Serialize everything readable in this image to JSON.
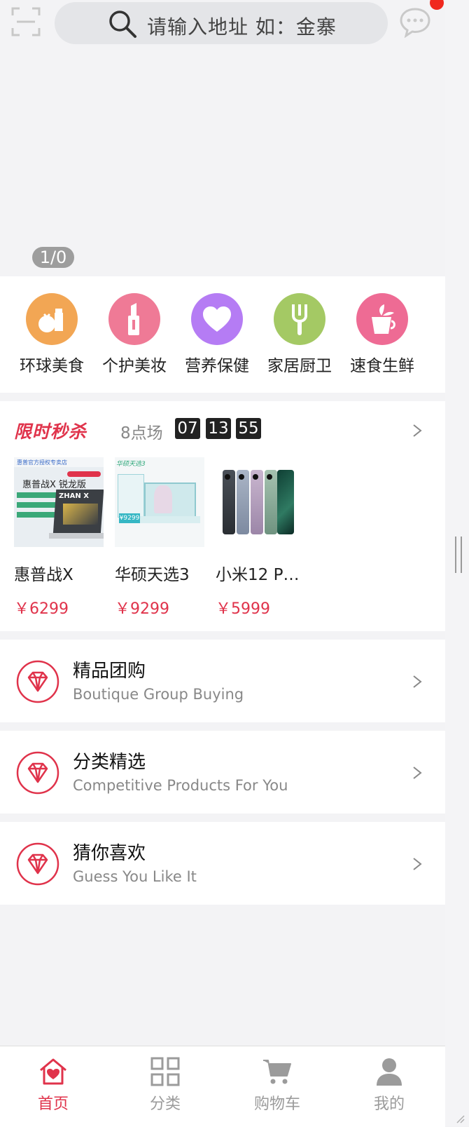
{
  "header": {
    "search_placeholder": "请输入地址 如：金寨"
  },
  "banner": {
    "indicator": "1/0"
  },
  "categories": [
    {
      "label": "环球美食",
      "color": "#f2a654",
      "icon": "fruit-bottle-icon"
    },
    {
      "label": "个护美妆",
      "color": "#ef7a96",
      "icon": "lipstick-icon"
    },
    {
      "label": "营养保健",
      "color": "#b57cf4",
      "icon": "heart-icon"
    },
    {
      "label": "家居厨卫",
      "color": "#a4c964",
      "icon": "fork-icon"
    },
    {
      "label": "速食生鲜",
      "color": "#ee6b94",
      "icon": "cup-icon"
    }
  ],
  "flash_sale": {
    "title": "限时秒杀",
    "session": "8点场",
    "countdown": {
      "hours": "07",
      "minutes": "13",
      "seconds": "55"
    },
    "products": [
      {
        "name": "惠普战X",
        "price": "￥6299",
        "img_lines": [
          "惠普官方授权专卖店",
          "惠普战X 锐龙版",
          "ZHAN X"
        ]
      },
      {
        "name": "华硕天选3",
        "price": "￥9299",
        "img_lines": [
          "华硕天选3",
          "¥9299"
        ]
      },
      {
        "name": "小米12 P…",
        "price": "￥5999",
        "img_lines": []
      }
    ]
  },
  "sections": [
    {
      "title": "精品团购",
      "subtitle": "Boutique Group Buying"
    },
    {
      "title": "分类精选",
      "subtitle": "Competitive Products For You"
    },
    {
      "title": "猜你喜欢",
      "subtitle": "Guess You Like It"
    }
  ],
  "tabbar": [
    {
      "label": "首页",
      "icon": "home-icon",
      "active": true
    },
    {
      "label": "分类",
      "icon": "grid-icon",
      "active": false
    },
    {
      "label": "购物车",
      "icon": "cart-icon",
      "active": false
    },
    {
      "label": "我的",
      "icon": "user-icon",
      "active": false
    }
  ],
  "colors": {
    "accent": "#e0334b",
    "page_bg": "#f3f3f5",
    "notification": "#f0281e"
  }
}
